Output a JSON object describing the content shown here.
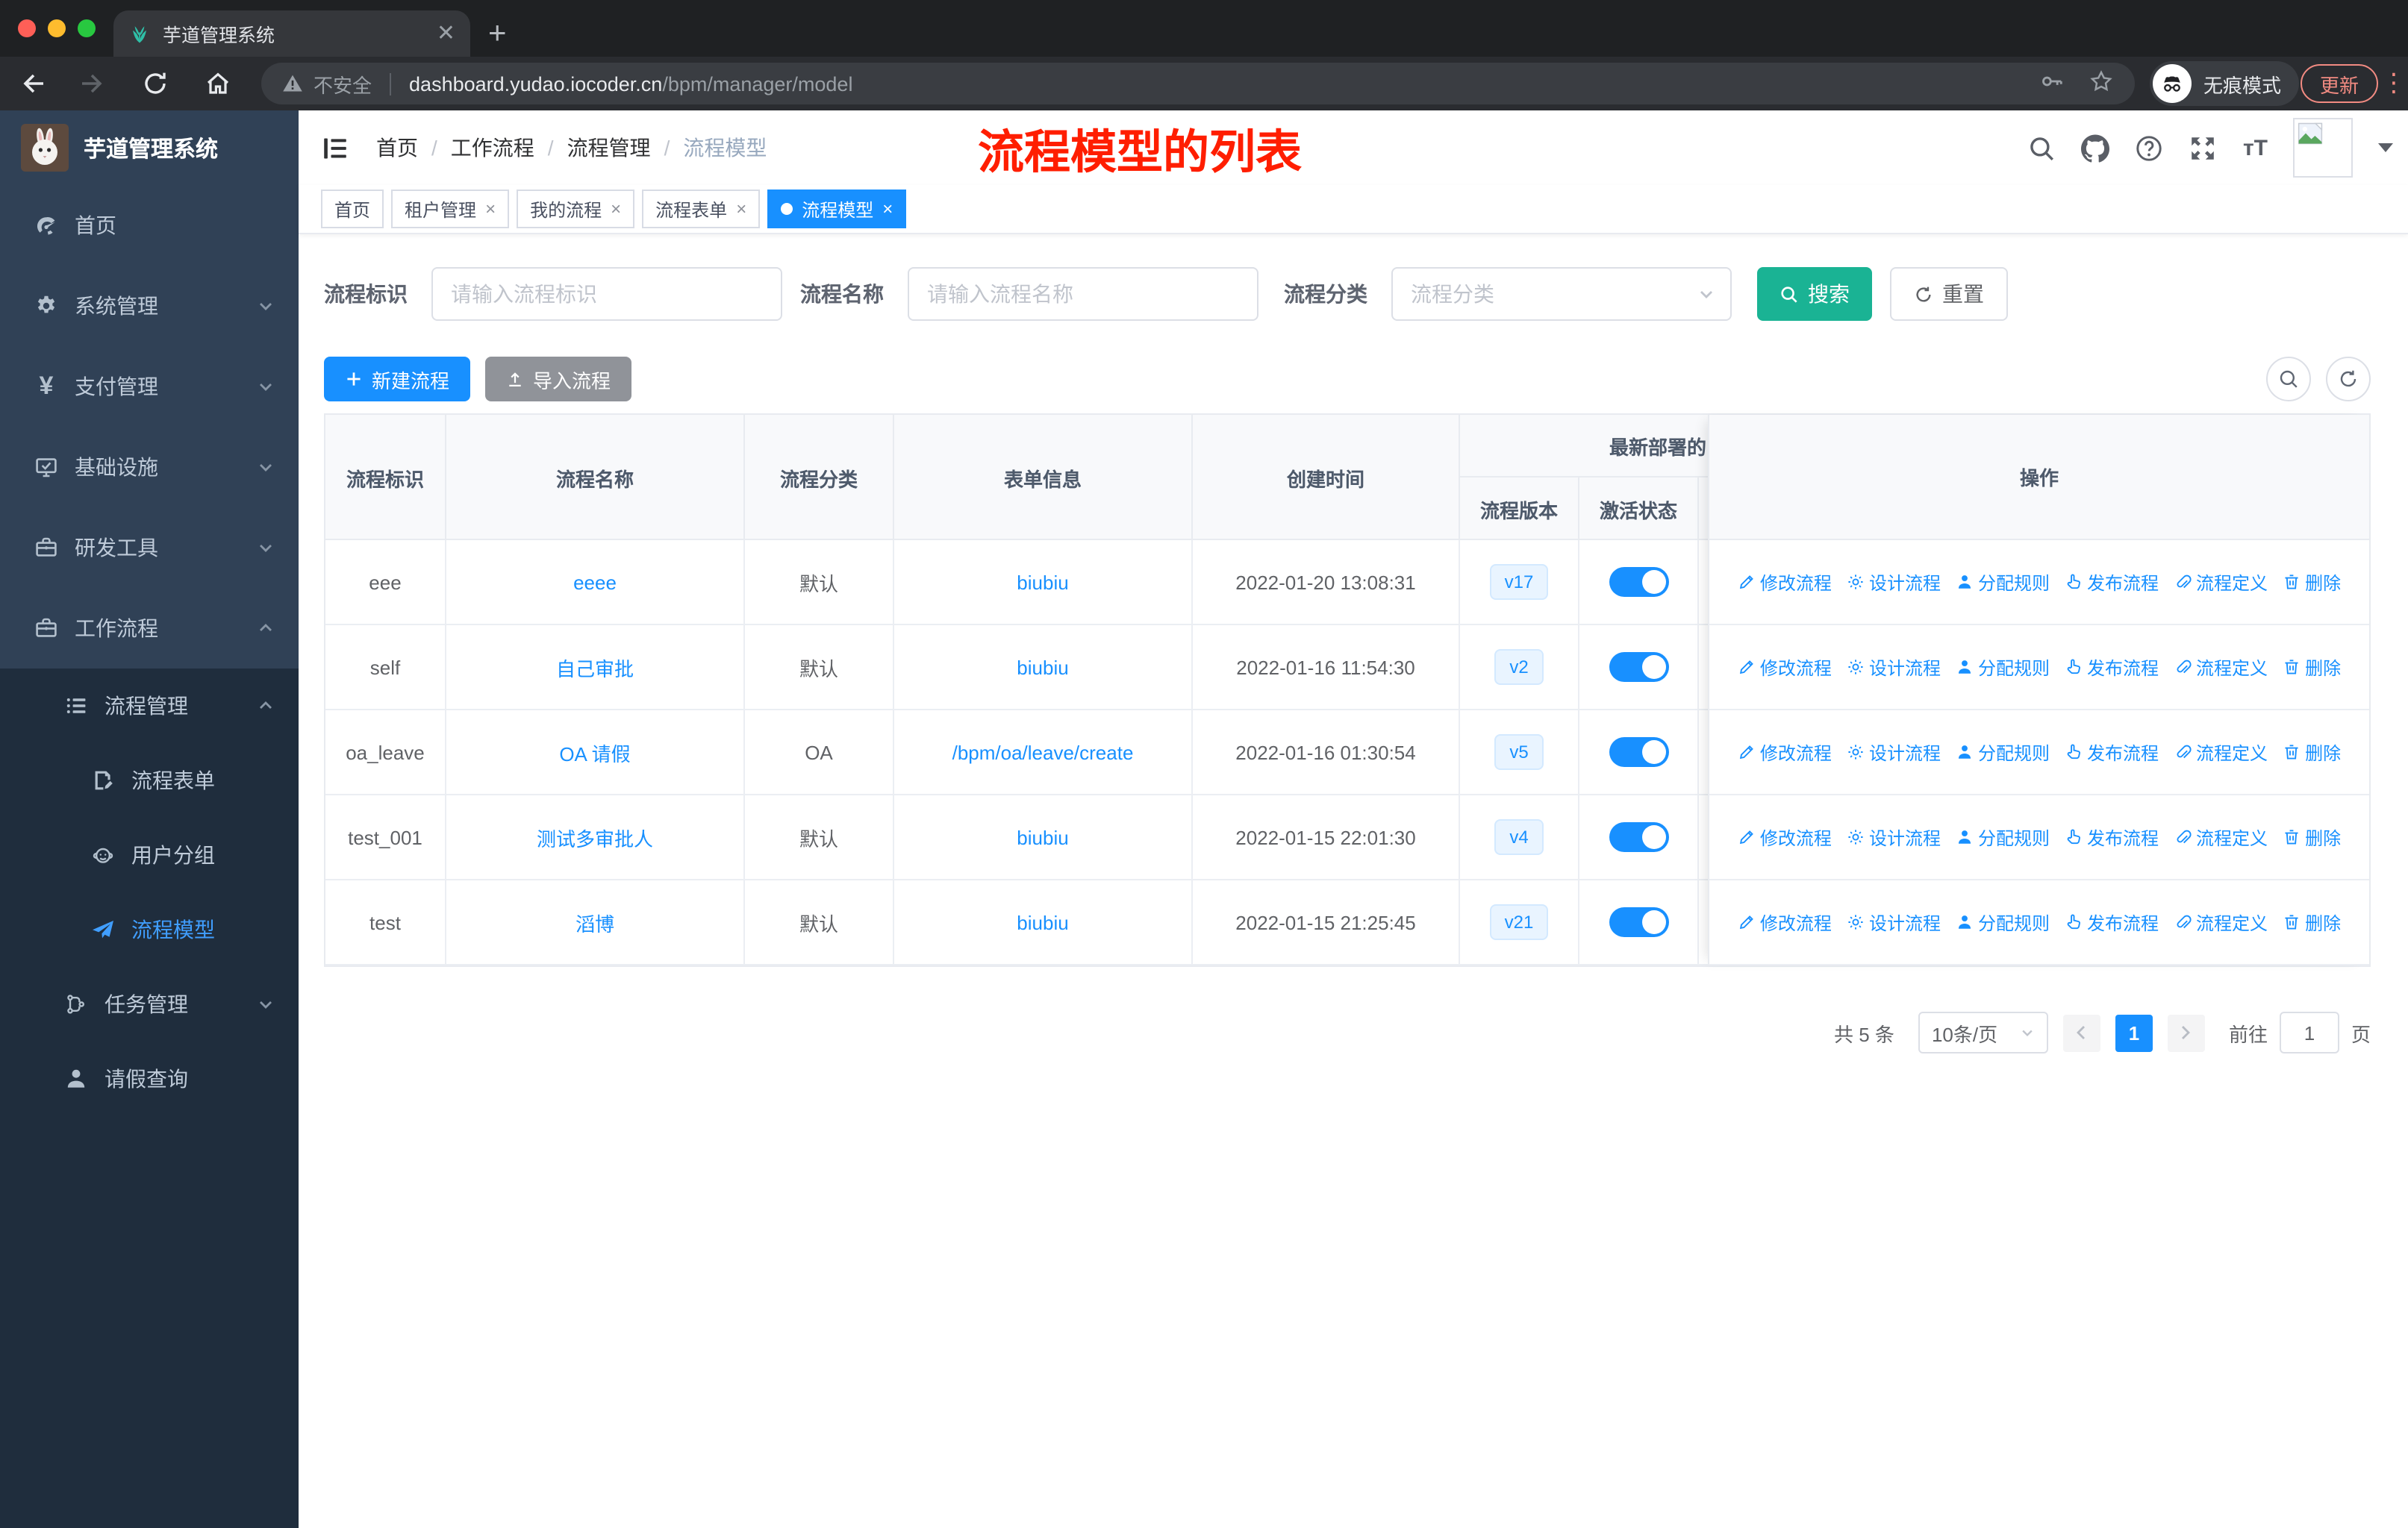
{
  "browser": {
    "tab_title": "芋道管理系统",
    "security_label": "不安全",
    "url_host": "dashboard.yudao.iocoder.cn",
    "url_path": "/bpm/manager/model",
    "incognito_label": "无痕模式",
    "update_label": "更新"
  },
  "sidebar": {
    "logo_title": "芋道管理系统",
    "items": [
      {
        "key": "home",
        "icon": "dashboard-icon",
        "label": "首页",
        "level": 1
      },
      {
        "key": "system",
        "icon": "gear-icon",
        "label": "系统管理",
        "level": 1,
        "chevron": "down"
      },
      {
        "key": "payment",
        "icon": "yen-icon",
        "label": "支付管理",
        "level": 1,
        "chevron": "down"
      },
      {
        "key": "infrastructure",
        "icon": "monitor-icon",
        "label": "基础设施",
        "level": 1,
        "chevron": "down"
      },
      {
        "key": "devtools",
        "icon": "briefcase-icon",
        "label": "研发工具",
        "level": 1,
        "chevron": "down"
      },
      {
        "key": "workflow",
        "icon": "briefcase-icon",
        "label": "工作流程",
        "level": 1,
        "chevron": "up"
      },
      {
        "key": "process-management",
        "icon": "list-tree-icon",
        "label": "流程管理",
        "level": 2,
        "chevron": "up"
      },
      {
        "key": "process-form",
        "icon": "form-icon",
        "label": "流程表单",
        "level": 3
      },
      {
        "key": "user-group",
        "icon": "user-group-icon",
        "label": "用户分组",
        "level": 3
      },
      {
        "key": "process-model",
        "icon": "paper-plane-icon",
        "label": "流程模型",
        "level": 3,
        "active": true
      },
      {
        "key": "task-management",
        "icon": "flow-icon",
        "label": "任务管理",
        "level": 2,
        "chevron": "down"
      },
      {
        "key": "leave-query",
        "icon": "person-icon",
        "label": "请假查询",
        "level": 2
      }
    ]
  },
  "header": {
    "breadcrumb": [
      "首页",
      "工作流程",
      "流程管理",
      "流程模型"
    ],
    "annotation": "流程模型的列表"
  },
  "tags": [
    {
      "key": "home",
      "label": "首页"
    },
    {
      "key": "tenant",
      "label": "租户管理",
      "closable": true
    },
    {
      "key": "my-process",
      "label": "我的流程",
      "closable": true
    },
    {
      "key": "process-form",
      "label": "流程表单",
      "closable": true
    },
    {
      "key": "process-model",
      "label": "流程模型",
      "closable": true,
      "active": true
    }
  ],
  "search": {
    "fields": [
      {
        "label": "流程标识",
        "placeholder": "请输入流程标识",
        "type": "input"
      },
      {
        "label": "流程名称",
        "placeholder": "请输入流程名称",
        "type": "input"
      },
      {
        "label": "流程分类",
        "placeholder": "流程分类",
        "type": "select"
      }
    ],
    "search_label": "搜索",
    "reset_label": "重置"
  },
  "toolbar": {
    "create_label": "新建流程",
    "import_label": "导入流程"
  },
  "table": {
    "columns": [
      "流程标识",
      "流程名称",
      "流程分类",
      "表单信息",
      "创建时间",
      "流程版本",
      "激活状态",
      "操作"
    ],
    "group_header": "最新部署的",
    "rows": [
      {
        "id": "eee",
        "name": "eeee",
        "category": "默认",
        "form": "biubiu",
        "created": "2022-01-20 13:08:31",
        "version": "v17",
        "active": true
      },
      {
        "id": "self",
        "name": "自己审批",
        "category": "默认",
        "form": "biubiu",
        "created": "2022-01-16 11:54:30",
        "version": "v2",
        "active": true
      },
      {
        "id": "oa_leave",
        "name": "OA 请假",
        "category": "OA",
        "form": "/bpm/oa/leave/create",
        "created": "2022-01-16 01:30:54",
        "version": "v5",
        "active": true
      },
      {
        "id": "test_001",
        "name": "测试多审批人",
        "category": "默认",
        "form": "biubiu",
        "created": "2022-01-15 22:01:30",
        "version": "v4",
        "active": true
      },
      {
        "id": "test",
        "name": "滔博",
        "category": "默认",
        "form": "biubiu",
        "created": "2022-01-15 21:25:45",
        "version": "v21",
        "active": true
      }
    ],
    "actions": [
      {
        "key": "modify",
        "icon": "edit-icon",
        "label": "修改流程"
      },
      {
        "key": "design",
        "icon": "design-icon",
        "label": "设计流程"
      },
      {
        "key": "assign",
        "icon": "assign-user-icon",
        "label": "分配规则"
      },
      {
        "key": "publish",
        "icon": "publish-icon",
        "label": "发布流程"
      },
      {
        "key": "definition",
        "icon": "paperclip-icon",
        "label": "流程定义"
      },
      {
        "key": "delete",
        "icon": "trash-icon",
        "label": "删除"
      }
    ]
  },
  "pagination": {
    "total_label": "共 5 条",
    "page_size": "10条/页",
    "current": "1",
    "goto_label": "前往",
    "goto_value": "1",
    "page_label": "页"
  },
  "colors": {
    "primary": "#1890ff",
    "search_button": "#1ab394",
    "import_button": "#909399",
    "annotation_red": "#ff1e00",
    "sidebar_bg": "#304156",
    "sidebar_submenu_bg": "#1f2d3d",
    "active_menu": "#409eff"
  }
}
